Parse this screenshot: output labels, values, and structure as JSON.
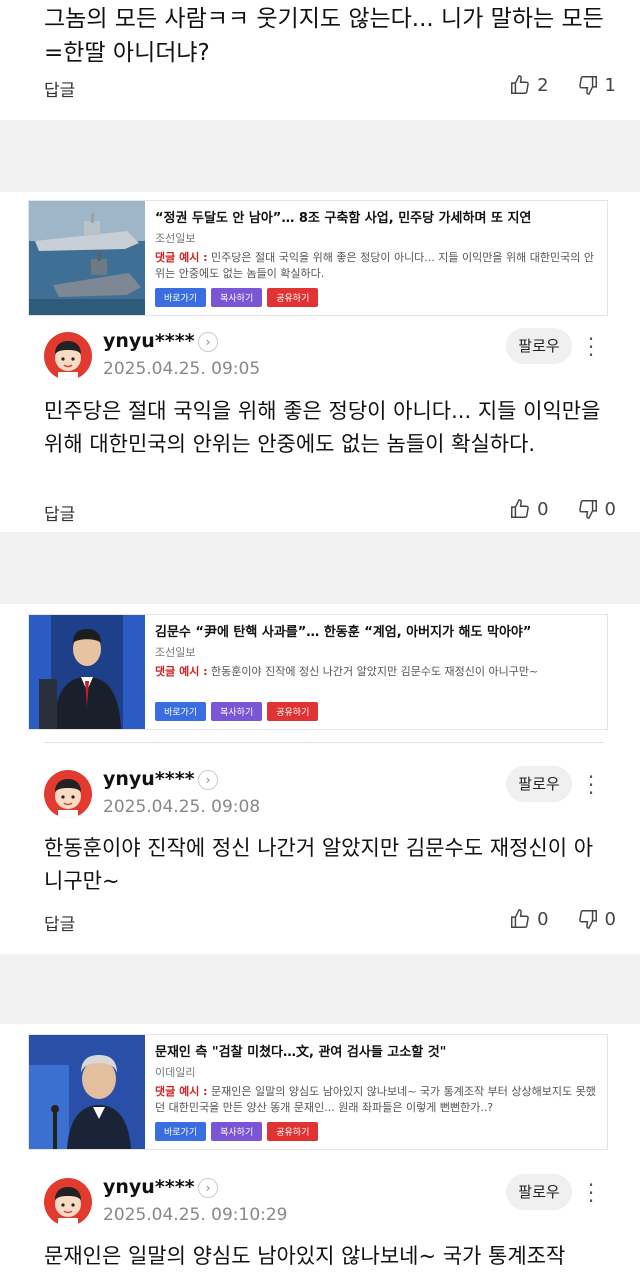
{
  "top_comment": {
    "body": "그놈의 모든 사람ㅋㅋ 웃기지도 않는다... 니가 말하는 모든 =한딸 아니더냐?",
    "reply_label": "답글",
    "likes": "2",
    "dislikes": "1"
  },
  "cards": [
    {
      "title": "“정권 두달도 안 남아”… 8조 구축함 사업, 민주당 가세하며 또 지연",
      "source": "조선일보",
      "comment_label": "댓글 예시 :",
      "comment_example": "민주당은 절대 국익을 위해 좋은 정당이 아니다... 지들 이익만을 위해 대한민국의 안위는 안중에도 없는 놈들이 확실하다.",
      "btn_go": "바로가기",
      "btn_copy": "복사하기",
      "btn_share": "공유하기"
    },
    {
      "title": "김문수 “尹에 탄핵 사과를”… 한동훈 “계엄, 아버지가 해도 막아야”",
      "source": "조선일보",
      "comment_label": "댓글 예시 :",
      "comment_example": "한동훈이야 진작에 정신 나간거 알았지만 김문수도 재정신이 아니구만~",
      "btn_go": "바로가기",
      "btn_copy": "복사하기",
      "btn_share": "공유하기"
    },
    {
      "title": "문재인 측 \"검찰 미쳤다…文, 관여 검사들 고소할 것\"",
      "source": "이데일리",
      "comment_label": "댓글 예시 :",
      "comment_example": "문재인은 일말의 양심도 남아있지 않나보네~ 국가 통계조작 부터 상상해보지도 못했던 대한민국을 만든 양산 똥개 문재인... 원래 좌파들은 이렇게 뻔뻔한가..?",
      "btn_go": "바로가기",
      "btn_copy": "복사하기",
      "btn_share": "공유하기"
    }
  ],
  "comments": [
    {
      "username": "ynyu****",
      "timestamp": "2025.04.25. 09:05",
      "follow_label": "팔로우",
      "body": "민주당은 절대 국익을 위해 좋은 정당이 아니다... 지들 이익만을 위해 대한민국의 안위는 안중에도 없는 놈들이 확실하다.",
      "reply_label": "답글",
      "likes": "0",
      "dislikes": "0"
    },
    {
      "username": "ynyu****",
      "timestamp": "2025.04.25. 09:08",
      "follow_label": "팔로우",
      "body": "한동훈이야 진작에 정신 나간거 알았지만 김문수도 재정신이 아니구만~",
      "reply_label": "답글",
      "likes": "0",
      "dislikes": "0"
    },
    {
      "username": "ynyu****",
      "timestamp": "2025.04.25. 09:10:29",
      "follow_label": "팔로우",
      "body": "문재인은 일말의 양심도 남아있지 않나보네~ 국가 통계조작"
    }
  ],
  "icons": {
    "like": "thumbs-up-icon",
    "dislike": "thumbs-down-icon",
    "more": "more-vertical-icon",
    "profile_link": "chevron-right-icon"
  }
}
